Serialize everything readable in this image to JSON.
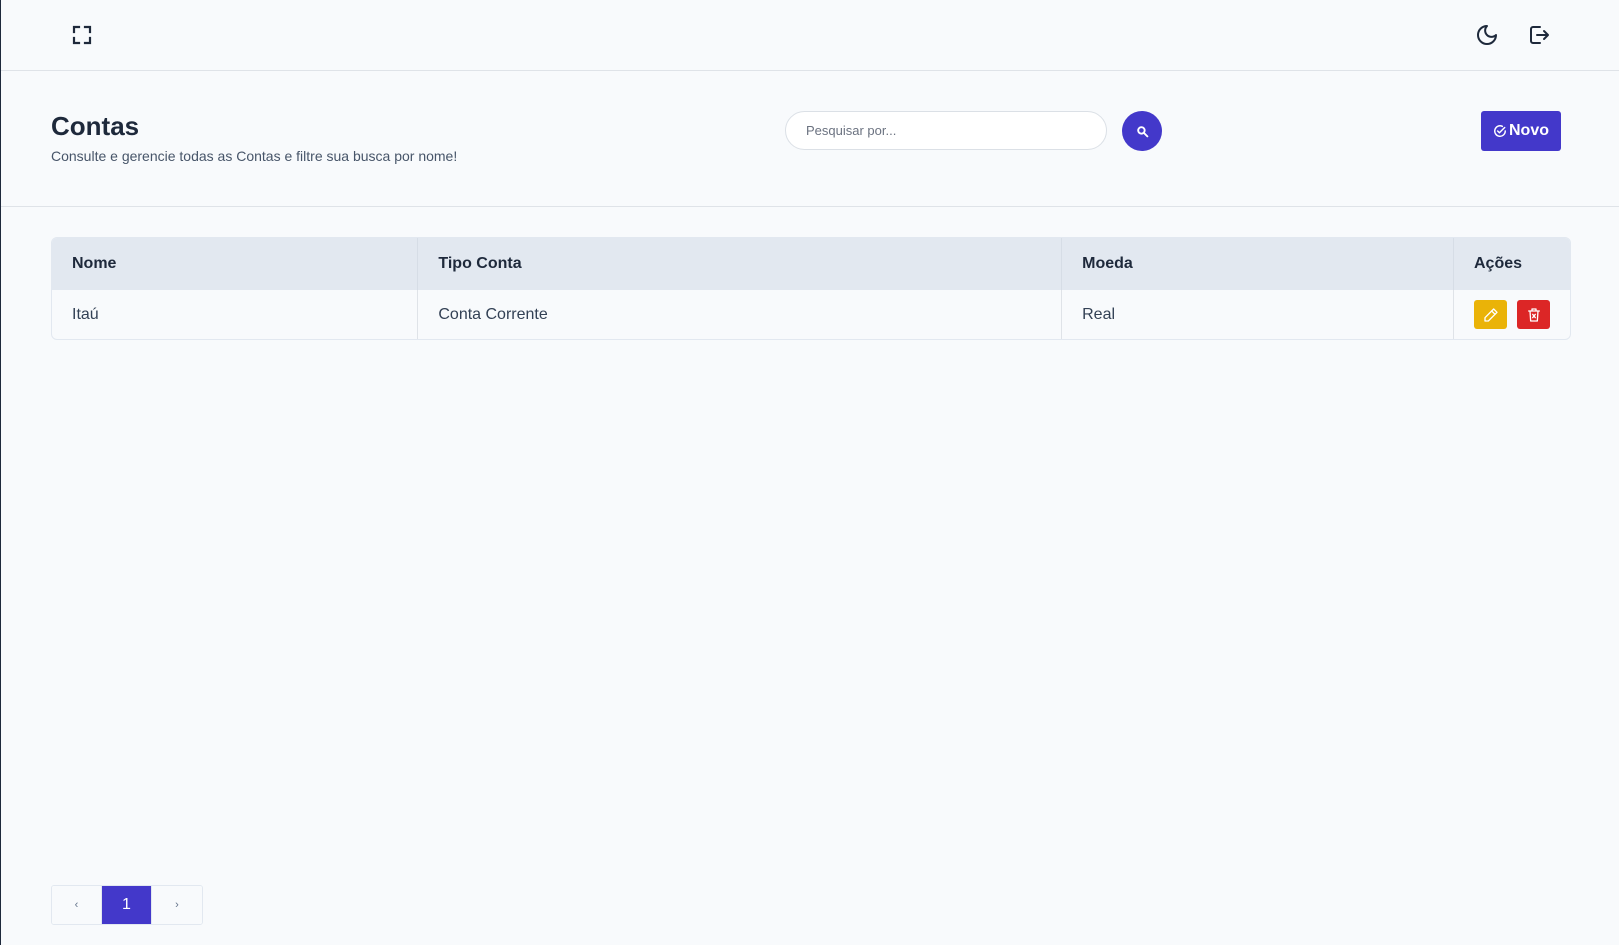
{
  "topbar": {
    "fullscreen_icon": "fullscreen-icon",
    "theme_icon": "moon-icon",
    "logout_icon": "logout-icon"
  },
  "header": {
    "title": "Contas",
    "subtitle": "Consulte e gerencie todas as Contas e filtre sua busca por nome!",
    "search": {
      "placeholder": "Pesquisar por...",
      "value": ""
    },
    "new_button_label": "Novo"
  },
  "table": {
    "columns": [
      "Nome",
      "Tipo Conta",
      "Moeda",
      "Ações"
    ],
    "rows": [
      {
        "nome": "Itaú",
        "tipo_conta": "Conta Corrente",
        "moeda": "Real"
      }
    ]
  },
  "pagination": {
    "prev_label": "‹",
    "current_page": "1",
    "next_label": "›"
  },
  "colors": {
    "primary": "#4338ca",
    "edit": "#eab308",
    "delete": "#dc2626",
    "header_row": "#e2e8f0"
  }
}
